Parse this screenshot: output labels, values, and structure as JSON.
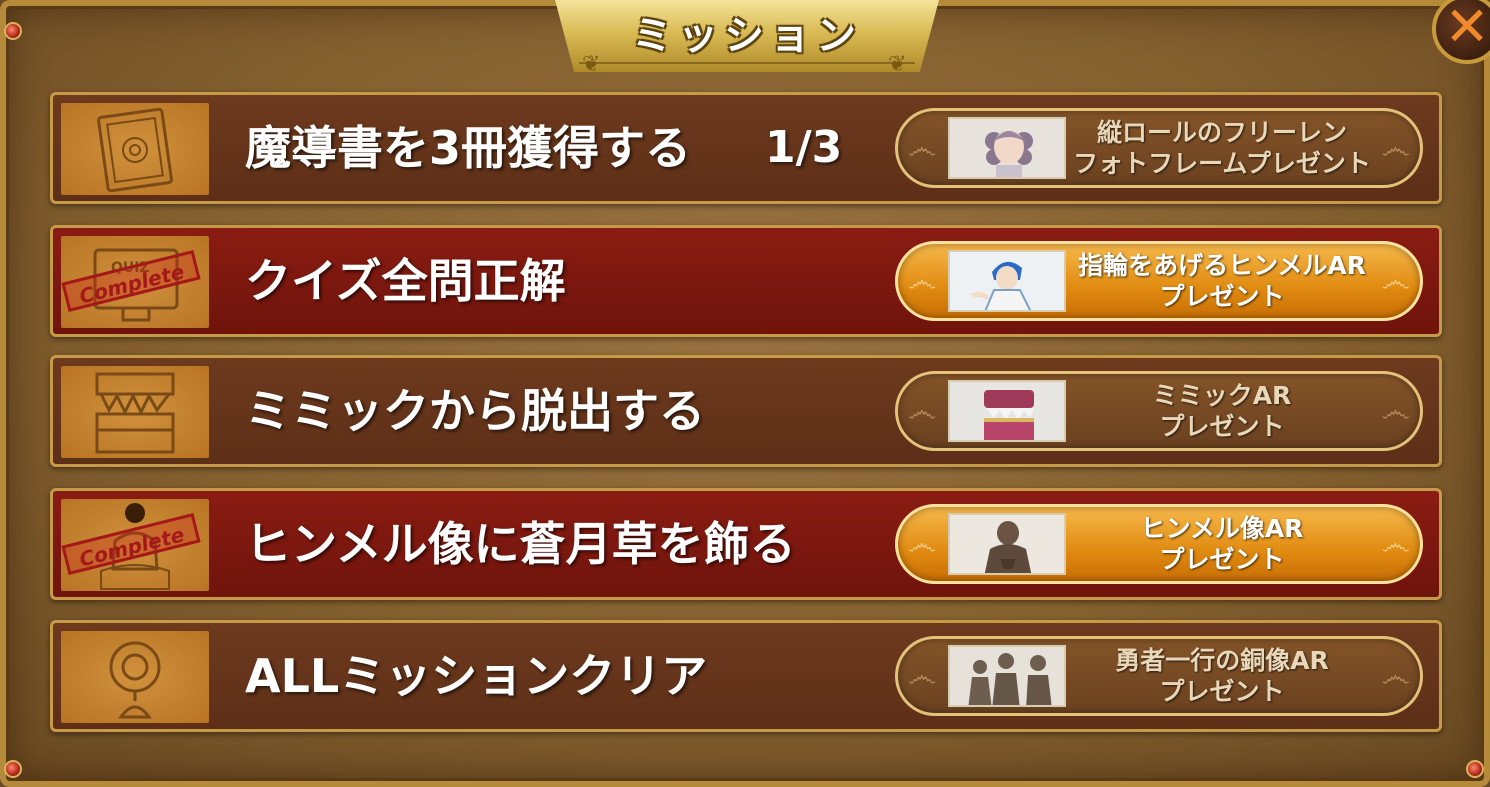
{
  "title": "ミッション",
  "close_icon": "close-icon",
  "missions": [
    {
      "text": "魔導書を3冊獲得する",
      "progress": "1/3",
      "icon": "grimoire-icon",
      "complete": false,
      "reward": {
        "line1": "縦ロールのフリーレン",
        "line2": "フォトフレームプレゼント",
        "thumb": "frieren-figure"
      }
    },
    {
      "text": "クイズ全問正解",
      "progress": "",
      "icon": "quiz-icon",
      "stamp": "Complete",
      "complete": true,
      "reward": {
        "line1": "指輪をあげるヒンメルAR",
        "line2": "プレゼント",
        "thumb": "himmel-figure"
      }
    },
    {
      "text": "ミミックから脱出する",
      "progress": "",
      "icon": "mimic-chest-icon",
      "complete": false,
      "reward": {
        "line1": "ミミックAR",
        "line2": "プレゼント",
        "thumb": "mimic-chest"
      }
    },
    {
      "text": "ヒンメル像に蒼月草を飾る",
      "progress": "",
      "icon": "himmel-statue-icon",
      "stamp": "Complete",
      "complete": true,
      "reward": {
        "line1": "ヒンメル像AR",
        "line2": "プレゼント",
        "thumb": "himmel-statue"
      }
    },
    {
      "text": "ALLミッションクリア",
      "progress": "",
      "icon": "globe-trophy-icon",
      "complete": false,
      "reward": {
        "line1": "勇者一行の銅像AR",
        "line2": "プレゼント",
        "thumb": "hero-party-statue"
      }
    }
  ],
  "colors": {
    "row_default": "#6e3a1e",
    "row_complete": "#8a1c12",
    "reward_active": "#e08a10",
    "gold_border": "#c79a48"
  }
}
